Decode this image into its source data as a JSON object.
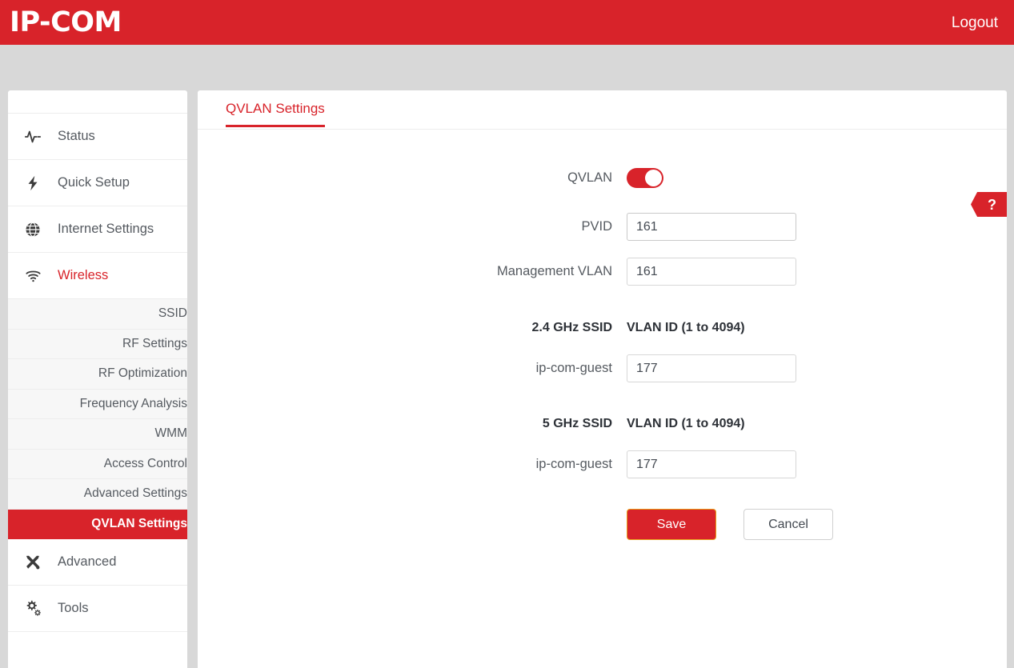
{
  "header": {
    "logo": "IP-COM",
    "logout_label": "Logout",
    "brand_color": "#d8232a"
  },
  "sidebar": {
    "items": [
      {
        "label": "Status",
        "icon": "pulse-icon",
        "active": false
      },
      {
        "label": "Quick Setup",
        "icon": "lightning-icon",
        "active": false
      },
      {
        "label": "Internet Settings",
        "icon": "globe-icon",
        "active": false
      },
      {
        "label": "Wireless",
        "icon": "wifi-icon",
        "active": true
      }
    ],
    "subitems": [
      {
        "label": "SSID",
        "selected": false
      },
      {
        "label": "RF Settings",
        "selected": false
      },
      {
        "label": "RF Optimization",
        "selected": false
      },
      {
        "label": "Frequency Analysis",
        "selected": false
      },
      {
        "label": "WMM",
        "selected": false
      },
      {
        "label": "Access Control",
        "selected": false
      },
      {
        "label": "Advanced Settings",
        "selected": false
      },
      {
        "label": "QVLAN Settings",
        "selected": true
      }
    ],
    "bottom_items": [
      {
        "label": "Advanced",
        "icon": "tools-cross-icon"
      },
      {
        "label": "Tools",
        "icon": "gears-icon"
      }
    ]
  },
  "main": {
    "tab_label": "QVLAN Settings",
    "help_icon": "question-mark-icon",
    "help_label": "?",
    "fields": {
      "qvlan": {
        "label": "QVLAN",
        "state": "on"
      },
      "pvid": {
        "label": "PVID",
        "value": "161",
        "placeholder": ""
      },
      "management_vlan": {
        "label": "Management VLAN",
        "value": "161",
        "placeholder": ""
      }
    },
    "bands": [
      {
        "ssid_header": "2.4 GHz SSID",
        "vlan_header": "VLAN ID (1 to 4094)",
        "ssid_name": "ip-com-guest",
        "vlan_value": "177"
      },
      {
        "ssid_header": "5 GHz SSID",
        "vlan_header": "VLAN ID (1 to 4094)",
        "ssid_name": "ip-com-guest",
        "vlan_value": "177"
      }
    ],
    "buttons": {
      "save": "Save",
      "cancel": "Cancel"
    }
  }
}
